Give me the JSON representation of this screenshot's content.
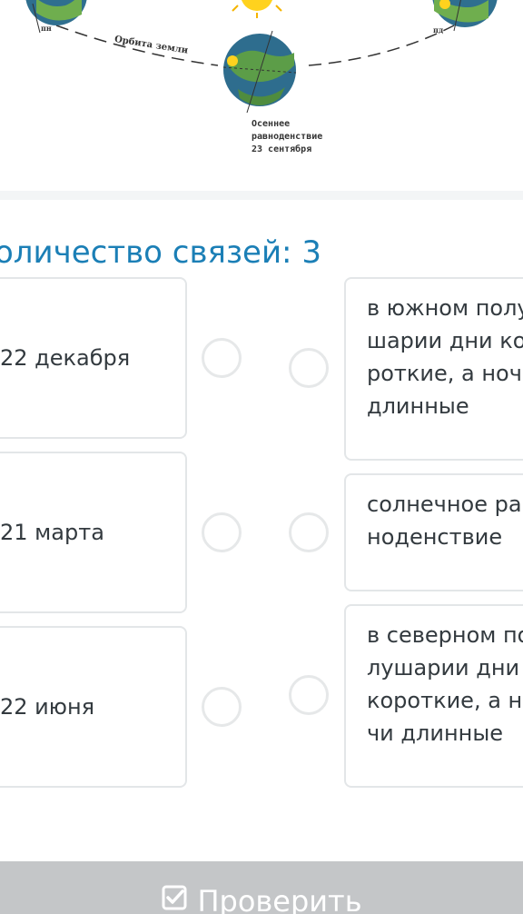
{
  "diagram": {
    "orbit_label": "Орбита земли",
    "caption_lines": [
      "Осеннее",
      "равноденствие",
      "23 сентября"
    ],
    "left_label": "пн",
    "right_label": "пд"
  },
  "heading": "оличество связей: 3",
  "left_items": [
    {
      "label": "22 декабря"
    },
    {
      "label": "21 марта"
    },
    {
      "label": "22 июня"
    }
  ],
  "right_items": [
    {
      "label": "в южном полушарии дни короткие, а ночи длинные"
    },
    {
      "label": "солнечное равноденствие"
    },
    {
      "label": "в северном полушарии дни короткие, а ночи длинные"
    }
  ],
  "check_button": {
    "label": "Проверить",
    "icon": "checkbox-icon"
  },
  "colors": {
    "accent": "#1b7fb6",
    "button_bg": "#c4c6c8",
    "card_border": "#e3e6e8",
    "text": "#333a3f"
  }
}
